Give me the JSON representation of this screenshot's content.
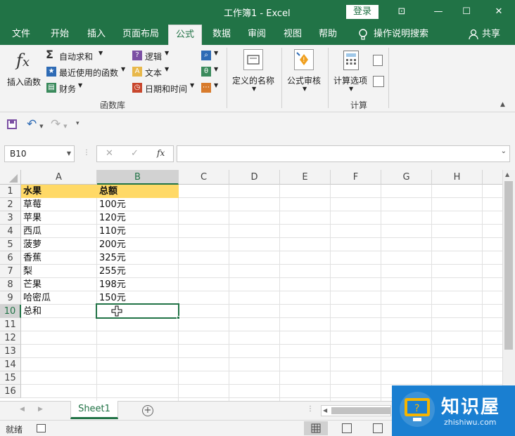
{
  "window": {
    "title": "工作簿1  -  Excel",
    "login_label": "登录",
    "controls": [
      "⊡",
      "—",
      "☐",
      "✕"
    ]
  },
  "tabs": [
    "文件",
    "开始",
    "插入",
    "页面布局",
    "公式",
    "数据",
    "审阅",
    "视图",
    "帮助"
  ],
  "active_tab": "公式",
  "tell_me": "操作说明搜索",
  "share_label": "共享",
  "ribbon": {
    "insert_function": "插入函数",
    "autosum": "自动求和",
    "recently_used": "最近使用的函数",
    "financial": "财务",
    "logical": "逻辑",
    "text": "文本",
    "datetime": "日期和时间",
    "library_group": "函数库",
    "defined_names": "定义的名称",
    "formula_auditing": "公式审核",
    "calc_options": "计算选项",
    "calc_group": "计算",
    "colors": {
      "purple": "#7b4fa3",
      "blue": "#2e6bb5",
      "orange": "#d87b2c",
      "green": "#3a8a5c"
    }
  },
  "qat": {
    "undo": "↶",
    "redo": "↷"
  },
  "formula_bar": {
    "name_box": "B10",
    "cancel": "✕",
    "enter": "✓",
    "fx": "fx",
    "value": ""
  },
  "sheet": {
    "columns": [
      "A",
      "B",
      "C",
      "D",
      "E",
      "F",
      "G",
      "H"
    ],
    "rows": [
      "1",
      "2",
      "3",
      "4",
      "5",
      "6",
      "7",
      "8",
      "9",
      "10",
      "11",
      "12",
      "13",
      "14",
      "15",
      "16"
    ],
    "header": {
      "a": "水果",
      "b": "总额"
    },
    "data": [
      {
        "fruit": "草莓",
        "amount": "100元"
      },
      {
        "fruit": "苹果",
        "amount": "120元"
      },
      {
        "fruit": "西瓜",
        "amount": "110元"
      },
      {
        "fruit": "菠萝",
        "amount": "200元"
      },
      {
        "fruit": "香蕉",
        "amount": "325元"
      },
      {
        "fruit": "梨",
        "amount": "255元"
      },
      {
        "fruit": "芒果",
        "amount": "198元"
      },
      {
        "fruit": "哈密瓜",
        "amount": "150元"
      }
    ],
    "total_label": "总和",
    "selected_cell": "B10",
    "header_fill": "#ffd966"
  },
  "sheet_tab": "Sheet1",
  "status": {
    "ready": "就绪"
  },
  "watermark": {
    "title": "知识屋",
    "url": "zhishiwu.com"
  }
}
